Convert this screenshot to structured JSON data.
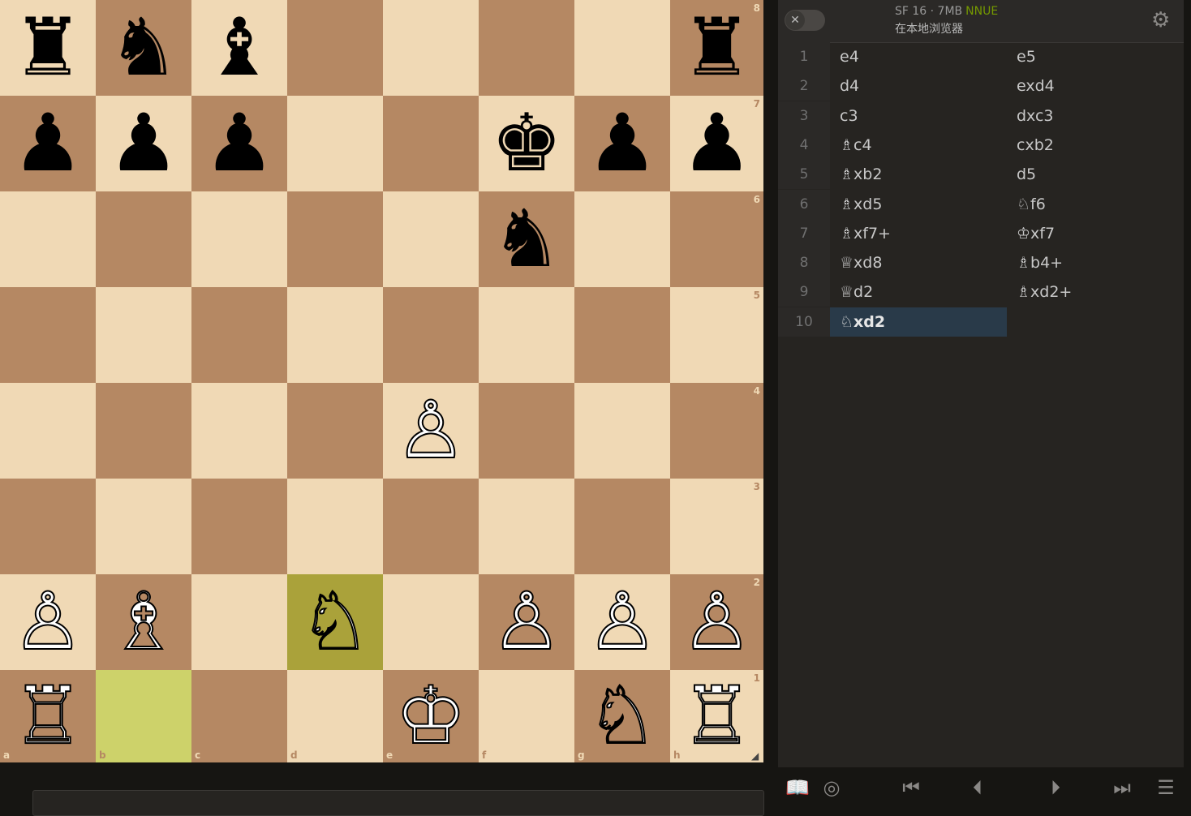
{
  "board": {
    "files": [
      "a",
      "b",
      "c",
      "d",
      "e",
      "f",
      "g",
      "h"
    ],
    "ranks": [
      "8",
      "7",
      "6",
      "5",
      "4",
      "3",
      "2",
      "1"
    ],
    "pieces": [
      {
        "square": "a8",
        "color": "b",
        "symbol": "♜",
        "name": "rook"
      },
      {
        "square": "b8",
        "color": "b",
        "symbol": "♞",
        "name": "knight"
      },
      {
        "square": "c8",
        "color": "b",
        "symbol": "♝",
        "name": "bishop"
      },
      {
        "square": "h8",
        "color": "b",
        "symbol": "♜",
        "name": "rook"
      },
      {
        "square": "a7",
        "color": "b",
        "symbol": "♟",
        "name": "pawn"
      },
      {
        "square": "b7",
        "color": "b",
        "symbol": "♟",
        "name": "pawn"
      },
      {
        "square": "c7",
        "color": "b",
        "symbol": "♟",
        "name": "pawn"
      },
      {
        "square": "f7",
        "color": "b",
        "symbol": "♚",
        "name": "king"
      },
      {
        "square": "g7",
        "color": "b",
        "symbol": "♟",
        "name": "pawn"
      },
      {
        "square": "h7",
        "color": "b",
        "symbol": "♟",
        "name": "pawn"
      },
      {
        "square": "f6",
        "color": "b",
        "symbol": "♞",
        "name": "knight"
      },
      {
        "square": "e4",
        "color": "w",
        "symbol": "♙",
        "name": "pawn"
      },
      {
        "square": "a2",
        "color": "w",
        "symbol": "♙",
        "name": "pawn"
      },
      {
        "square": "b2",
        "color": "w",
        "symbol": "♗",
        "name": "bishop"
      },
      {
        "square": "d2",
        "color": "w",
        "symbol": "♘",
        "name": "knight"
      },
      {
        "square": "f2",
        "color": "w",
        "symbol": "♙",
        "name": "pawn"
      },
      {
        "square": "g2",
        "color": "w",
        "symbol": "♙",
        "name": "pawn"
      },
      {
        "square": "h2",
        "color": "w",
        "symbol": "♙",
        "name": "pawn"
      },
      {
        "square": "a1",
        "color": "w",
        "symbol": "♖",
        "name": "rook"
      },
      {
        "square": "e1",
        "color": "w",
        "symbol": "♔",
        "name": "king"
      },
      {
        "square": "g1",
        "color": "w",
        "symbol": "♘",
        "name": "knight"
      },
      {
        "square": "h1",
        "color": "w",
        "symbol": "♖",
        "name": "rook"
      }
    ],
    "last_move": {
      "from": "b1",
      "to": "d2"
    },
    "colors": {
      "light": "#f0d9b5",
      "dark": "#b58863",
      "from": "#cdd26a",
      "to": "#aaa23a"
    }
  },
  "engine": {
    "name": "SF 16 · 7MB",
    "badge": "NNUE",
    "subtitle": "在本地浏览器",
    "toggle_icon": "✕",
    "settings_icon": "gear-icon"
  },
  "moves": [
    {
      "num": "1",
      "white": "e4",
      "black": "e5"
    },
    {
      "num": "2",
      "white": "d4",
      "black": "exd4"
    },
    {
      "num": "3",
      "white": "c3",
      "black": "dxc3"
    },
    {
      "num": "4",
      "white": "♗c4",
      "black": "cxb2"
    },
    {
      "num": "5",
      "white": "♗xb2",
      "black": "d5"
    },
    {
      "num": "6",
      "white": "♗xd5",
      "black": "♘f6"
    },
    {
      "num": "7",
      "white": "♗xf7+",
      "black": "♔xf7"
    },
    {
      "num": "8",
      "white": "♕xd8",
      "black": "♗b4+"
    },
    {
      "num": "9",
      "white": "♕d2",
      "black": "♗xd2+"
    },
    {
      "num": "10",
      "white": "♘xd2",
      "black": ""
    }
  ],
  "active_move": "10.white",
  "controls": [
    {
      "name": "opening-book-icon",
      "glyph": "📖"
    },
    {
      "name": "practice-target-icon",
      "glyph": "◎"
    },
    {
      "name": "first-move-icon",
      "glyph": "⏮"
    },
    {
      "name": "previous-move-icon",
      "glyph": "⏴"
    },
    {
      "name": "next-move-icon",
      "glyph": "⏵"
    },
    {
      "name": "last-move-icon",
      "glyph": "⏭"
    },
    {
      "name": "menu-icon",
      "glyph": "☰"
    }
  ]
}
